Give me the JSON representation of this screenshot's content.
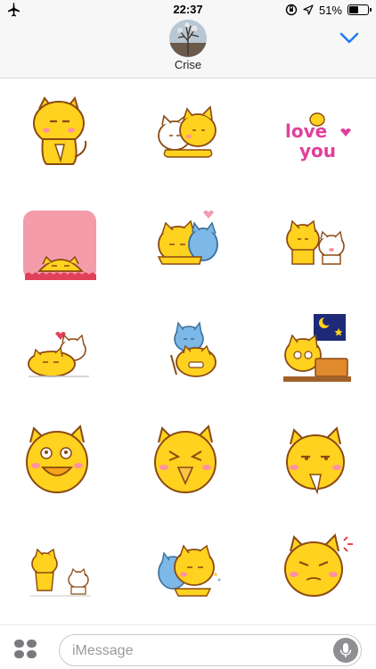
{
  "status_bar": {
    "time": "22:37",
    "battery_text": "51%",
    "battery_level": 0.51,
    "icons": [
      "airplane-icon",
      "orientation-lock-icon",
      "location-arrow-icon",
      "battery-icon"
    ]
  },
  "header": {
    "contact_name": "Crise",
    "avatar": "contact-avatar-photo",
    "collapse_icon": "chevron-down-icon"
  },
  "stickers": [
    {
      "name": "yellow-cat-sitting-sticker"
    },
    {
      "name": "yellow-and-white-cats-hugging-sticker"
    },
    {
      "name": "love-you-sticker",
      "text": "love you"
    },
    {
      "name": "cat-peeking-pink-sign-sticker"
    },
    {
      "name": "yellow-cat-hugging-blue-cat-sticker"
    },
    {
      "name": "yellow-cat-and-white-cat-sticker"
    },
    {
      "name": "cats-lying-heart-sticker"
    },
    {
      "name": "blue-cat-on-yellow-cat-sticker"
    },
    {
      "name": "cat-at-laptop-night-sticker"
    },
    {
      "name": "excited-cat-sticker"
    },
    {
      "name": "laughing-cat-sticker"
    },
    {
      "name": "smug-cat-sticker"
    },
    {
      "name": "cats-walking-sticker"
    },
    {
      "name": "cats-cuddling-sticker"
    },
    {
      "name": "annoyed-cat-sticker"
    }
  ],
  "input": {
    "placeholder": "iMessage",
    "apps_icon": "app-drawer-icon",
    "mic_icon": "microphone-icon"
  },
  "colors": {
    "cat_yellow": "#FFD21F",
    "outline": "#8B4A12",
    "cheek": "#FF8FA3",
    "accent_blue": "#1E7CF2",
    "love_pink": "#E0409A"
  }
}
